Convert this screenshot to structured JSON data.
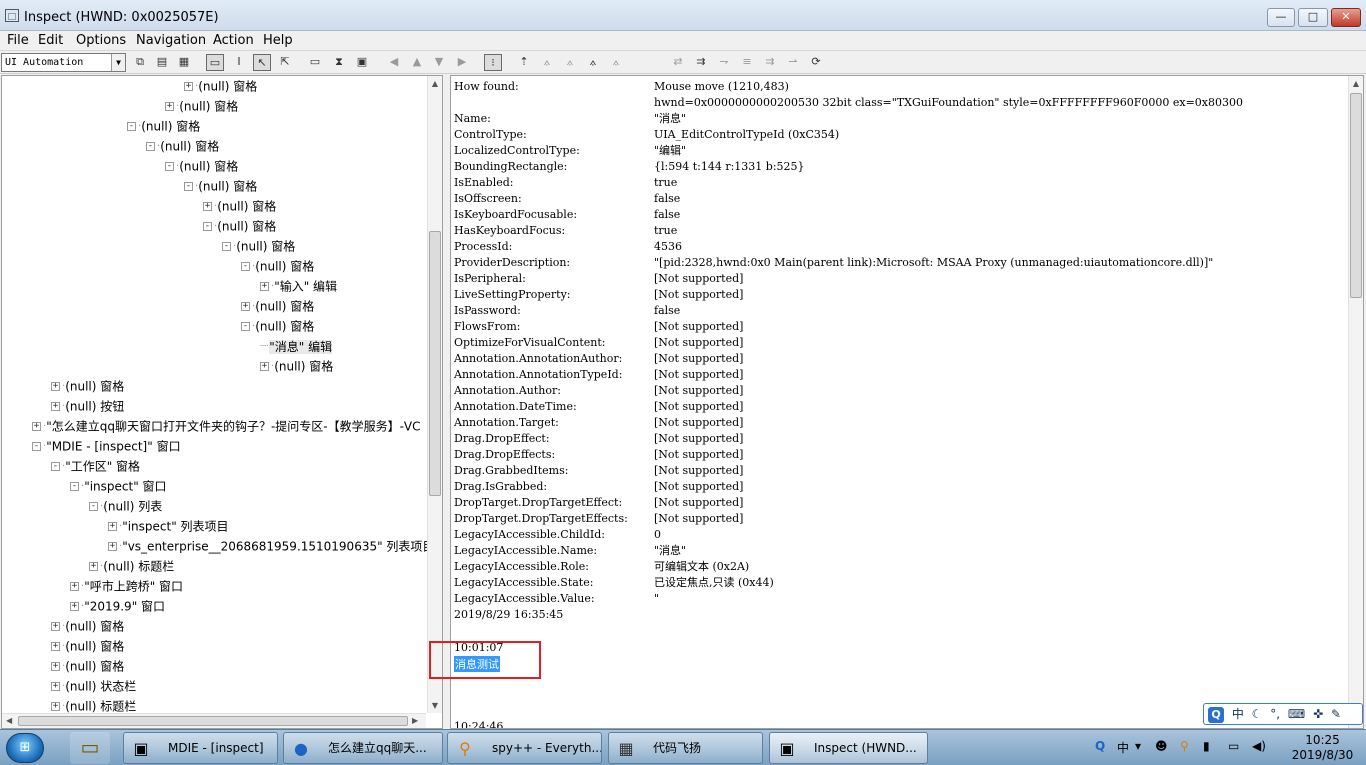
{
  "window": {
    "title": "Inspect  (HWND: 0x0025057E)",
    "controls": {
      "minimize": "—",
      "maximize": "□",
      "close": "✕"
    }
  },
  "menubar": [
    "File",
    "Edit",
    "Options",
    "Navigation",
    "Action",
    "Help"
  ],
  "toolbar": {
    "mode": "UI Automation",
    "icons": [
      "copy-icon",
      "clipboard-icon",
      "properties-icon",
      "highlight-rect-icon",
      "caret-icon",
      "select-cursor-icon",
      "hover-icon",
      "rectangle-icon",
      "hourglass-icon",
      "text-box-icon",
      "nav-back-icon",
      "nav-up-icon",
      "nav-down-icon",
      "nav-forward-icon",
      "tree-view-icon",
      "parent-icon",
      "first-child-icon",
      "next-sibling-icon",
      "prev-sibling-icon",
      "last-child-icon",
      "refresh-icon"
    ]
  },
  "tree": {
    "rows": [
      {
        "label": "(null) 窗格",
        "prefix": "+"
      },
      {
        "label": "(null) 窗格",
        "prefix": "+"
      },
      {
        "label": "(null) 窗格",
        "prefix": "-"
      },
      {
        "label": "(null) 窗格",
        "prefix": "-"
      },
      {
        "label": "(null) 窗格",
        "prefix": "-"
      },
      {
        "label": "(null) 窗格",
        "prefix": "-"
      },
      {
        "label": "(null) 窗格",
        "prefix": "+"
      },
      {
        "label": "(null) 窗格",
        "prefix": "-"
      },
      {
        "label": "(null) 窗格",
        "prefix": "-"
      },
      {
        "label": "(null) 窗格",
        "prefix": "-"
      },
      {
        "label": "\"输入\" 编辑",
        "prefix": "+"
      },
      {
        "label": "(null) 窗格",
        "prefix": "+"
      },
      {
        "label": "(null) 窗格",
        "prefix": "-"
      },
      {
        "label": "\"消息\" 编辑",
        "prefix": ""
      },
      {
        "label": "(null) 窗格",
        "prefix": "+"
      },
      {
        "label": "(null) 窗格",
        "prefix": "+"
      },
      {
        "label": "(null) 按钮",
        "prefix": "+"
      },
      {
        "label": "\"怎么建立qq聊天窗口打开文件夹的钩子？-提问专区-【教学服务】-VC",
        "prefix": "+"
      },
      {
        "label": "\"MDIE - [inspect]\" 窗口",
        "prefix": "-"
      },
      {
        "label": "\"工作区\" 窗格",
        "prefix": "-"
      },
      {
        "label": "\"inspect\" 窗口",
        "prefix": "-"
      },
      {
        "label": "(null) 列表",
        "prefix": "-"
      },
      {
        "label": "\"inspect\" 列表项目",
        "prefix": "+"
      },
      {
        "label": "\"vs_enterprise__2068681959.1510190635\" 列表项目",
        "prefix": "+"
      },
      {
        "label": "(null) 标题栏",
        "prefix": "+"
      },
      {
        "label": "\"呼市上跨桥\" 窗口",
        "prefix": "+"
      },
      {
        "label": "\"2019.9\" 窗口",
        "prefix": "+"
      },
      {
        "label": "(null) 窗格",
        "prefix": "+"
      },
      {
        "label": "(null) 窗格",
        "prefix": "+"
      },
      {
        "label": "(null) 窗格",
        "prefix": "+"
      },
      {
        "label": "(null) 状态栏",
        "prefix": "+"
      },
      {
        "label": "(null) 标题栏",
        "prefix": "+"
      }
    ]
  },
  "details": [
    {
      "key": "How found:",
      "value": "Mouse move (1210,483)"
    },
    {
      "key": "",
      "value": "hwnd=0x0000000000200530 32bit class=\"TXGuiFoundation\" style=0xFFFFFFFF960F0000 ex=0x80300"
    },
    {
      "key": "Name:",
      "value": "\"消息\""
    },
    {
      "key": "ControlType:",
      "value": "UIA_EditControlTypeId (0xC354)"
    },
    {
      "key": "LocalizedControlType:",
      "value": "\"编辑\""
    },
    {
      "key": "BoundingRectangle:",
      "value": "{l:594 t:144 r:1331 b:525}"
    },
    {
      "key": "IsEnabled:",
      "value": "true"
    },
    {
      "key": "IsOffscreen:",
      "value": "false"
    },
    {
      "key": "IsKeyboardFocusable:",
      "value": "false"
    },
    {
      "key": "HasKeyboardFocus:",
      "value": "true"
    },
    {
      "key": "ProcessId:",
      "value": "4536"
    },
    {
      "key": "ProviderDescription:",
      "value": "\"[pid:2328,hwnd:0x0 Main(parent link):Microsoft: MSAA Proxy (unmanaged:uiautomationcore.dll)]\""
    },
    {
      "key": "IsPeripheral:",
      "value": "[Not supported]"
    },
    {
      "key": "LiveSettingProperty:",
      "value": "[Not supported]"
    },
    {
      "key": "IsPassword:",
      "value": "false"
    },
    {
      "key": "FlowsFrom:",
      "value": "[Not supported]"
    },
    {
      "key": "OptimizeForVisualContent:",
      "value": "[Not supported]"
    },
    {
      "key": "Annotation.AnnotationAuthor:",
      "value": "[Not supported]"
    },
    {
      "key": "Annotation.AnnotationTypeId:",
      "value": "[Not supported]"
    },
    {
      "key": "Annotation.Author:",
      "value": "[Not supported]"
    },
    {
      "key": "Annotation.DateTime:",
      "value": "[Not supported]"
    },
    {
      "key": "Annotation.Target:",
      "value": "[Not supported]"
    },
    {
      "key": "Drag.DropEffect:",
      "value": "[Not supported]"
    },
    {
      "key": "Drag.DropEffects:",
      "value": "[Not supported]"
    },
    {
      "key": "Drag.GrabbedItems:",
      "value": "[Not supported]"
    },
    {
      "key": "Drag.IsGrabbed:",
      "value": "[Not supported]"
    },
    {
      "key": "DropTarget.DropTargetEffect:",
      "value": "[Not supported]"
    },
    {
      "key": "DropTarget.DropTargetEffects:",
      "value": "[Not supported]"
    },
    {
      "key": "LegacyIAccessible.ChildId:",
      "value": "0"
    },
    {
      "key": "LegacyIAccessible.Name:",
      "value": "\"消息\""
    },
    {
      "key": "LegacyIAccessible.Role:",
      "value": "可编辑文本 (0x2A)"
    },
    {
      "key": "LegacyIAccessible.State:",
      "value": "已设定焦点,只读 (0x44)"
    },
    {
      "key": "LegacyIAccessible.Value:",
      "value": "\""
    },
    {
      "key": "2019/8/29 16:35:45",
      "value": ""
    }
  ],
  "log": {
    "time1": "10:01:07",
    "message": "消息测试",
    "time2": "10:24:46"
  },
  "ime_bar": {
    "mode": "中",
    "icons": [
      "moon-icon",
      "punctuation-icon",
      "soft-keyboard-icon",
      "toolbox-icon",
      "settings-wrench-icon"
    ]
  },
  "taskbar": {
    "tasks": [
      {
        "label": "MDIE - [inspect]",
        "icon": "mdi-icon"
      },
      {
        "label": "怎么建立qq聊天...",
        "icon": "browser-icon"
      },
      {
        "label": "spy++ - Everyth...",
        "icon": "search-magnifier-icon"
      },
      {
        "label": "代码飞扬",
        "icon": "code-app-icon"
      },
      {
        "label": "Inspect  (HWND...",
        "icon": "inspect-icon"
      }
    ],
    "tray": {
      "ime": "中"
    },
    "clock": {
      "time": "10:25",
      "date": "2019/8/30"
    }
  },
  "colors": {
    "selection": "#3399ff",
    "highlight_box": "#e02020",
    "taskbar": "#7aa0c2"
  }
}
